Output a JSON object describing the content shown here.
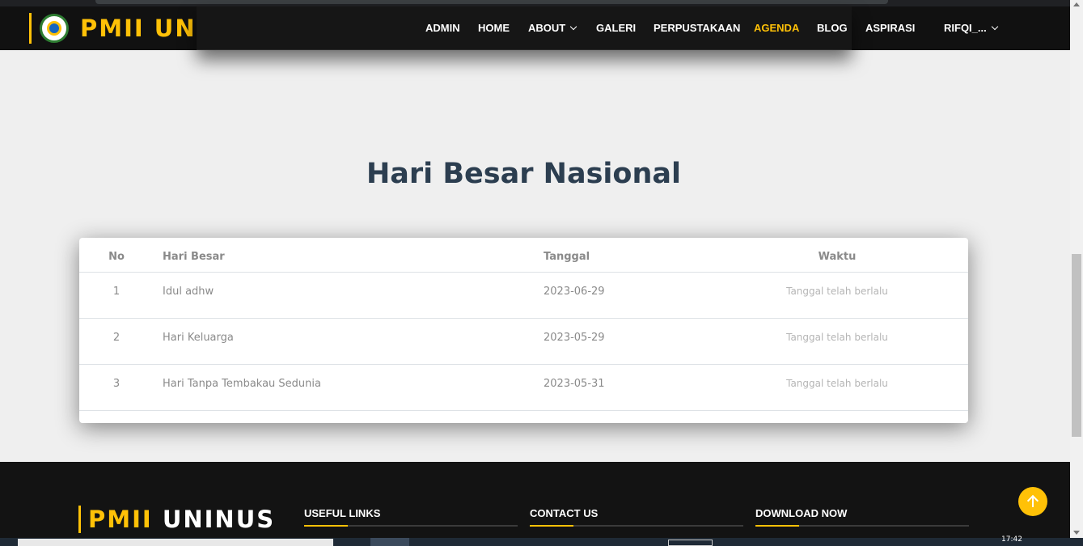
{
  "header": {
    "brand": "PMII UNINUS",
    "nav": [
      {
        "label": "ADMIN",
        "active": false,
        "dropdown": false
      },
      {
        "label": "HOME",
        "active": false,
        "dropdown": false
      },
      {
        "label": "ABOUT",
        "active": false,
        "dropdown": true
      },
      {
        "label": "GALERI",
        "active": false,
        "dropdown": false
      },
      {
        "label": "PERPUSTAKAAN",
        "active": false,
        "dropdown": false
      },
      {
        "label": "AGENDA",
        "active": true,
        "dropdown": false
      },
      {
        "label": "BLOG",
        "active": false,
        "dropdown": false
      },
      {
        "label": "ASPIRASI",
        "active": false,
        "dropdown": false
      },
      {
        "label": "RIFQI_...",
        "active": false,
        "dropdown": true
      }
    ]
  },
  "section": {
    "title": "Hari Besar Nasional"
  },
  "table": {
    "columns": [
      "No",
      "Hari Besar",
      "Tanggal",
      "Waktu"
    ],
    "rows": [
      {
        "no": "1",
        "hari": "Idul adhw",
        "tanggal": "2023-06-29",
        "waktu": "Tanggal telah berlalu"
      },
      {
        "no": "2",
        "hari": "Hari Keluarga",
        "tanggal": "2023-05-29",
        "waktu": "Tanggal telah berlalu"
      },
      {
        "no": "3",
        "hari": "Hari Tanpa Tembakau Sedunia",
        "tanggal": "2023-05-31",
        "waktu": "Tanggal telah berlalu"
      }
    ]
  },
  "footer": {
    "brand_part1": "PMII",
    "brand_part2": "UNINUS",
    "columns": [
      {
        "title": "USEFUL LINKS"
      },
      {
        "title": "CONTACT US"
      },
      {
        "title": "DOWNLOAD NOW"
      }
    ]
  },
  "taskbar": {
    "clock": "17:42"
  },
  "colors": {
    "accent": "#ffc107",
    "header_bg": "#111111",
    "title": "#2c3e50"
  },
  "icons": {
    "logo": "pmii-logo-icon",
    "dropdown": "chevron-down-icon",
    "back_to_top": "arrow-up-icon"
  }
}
